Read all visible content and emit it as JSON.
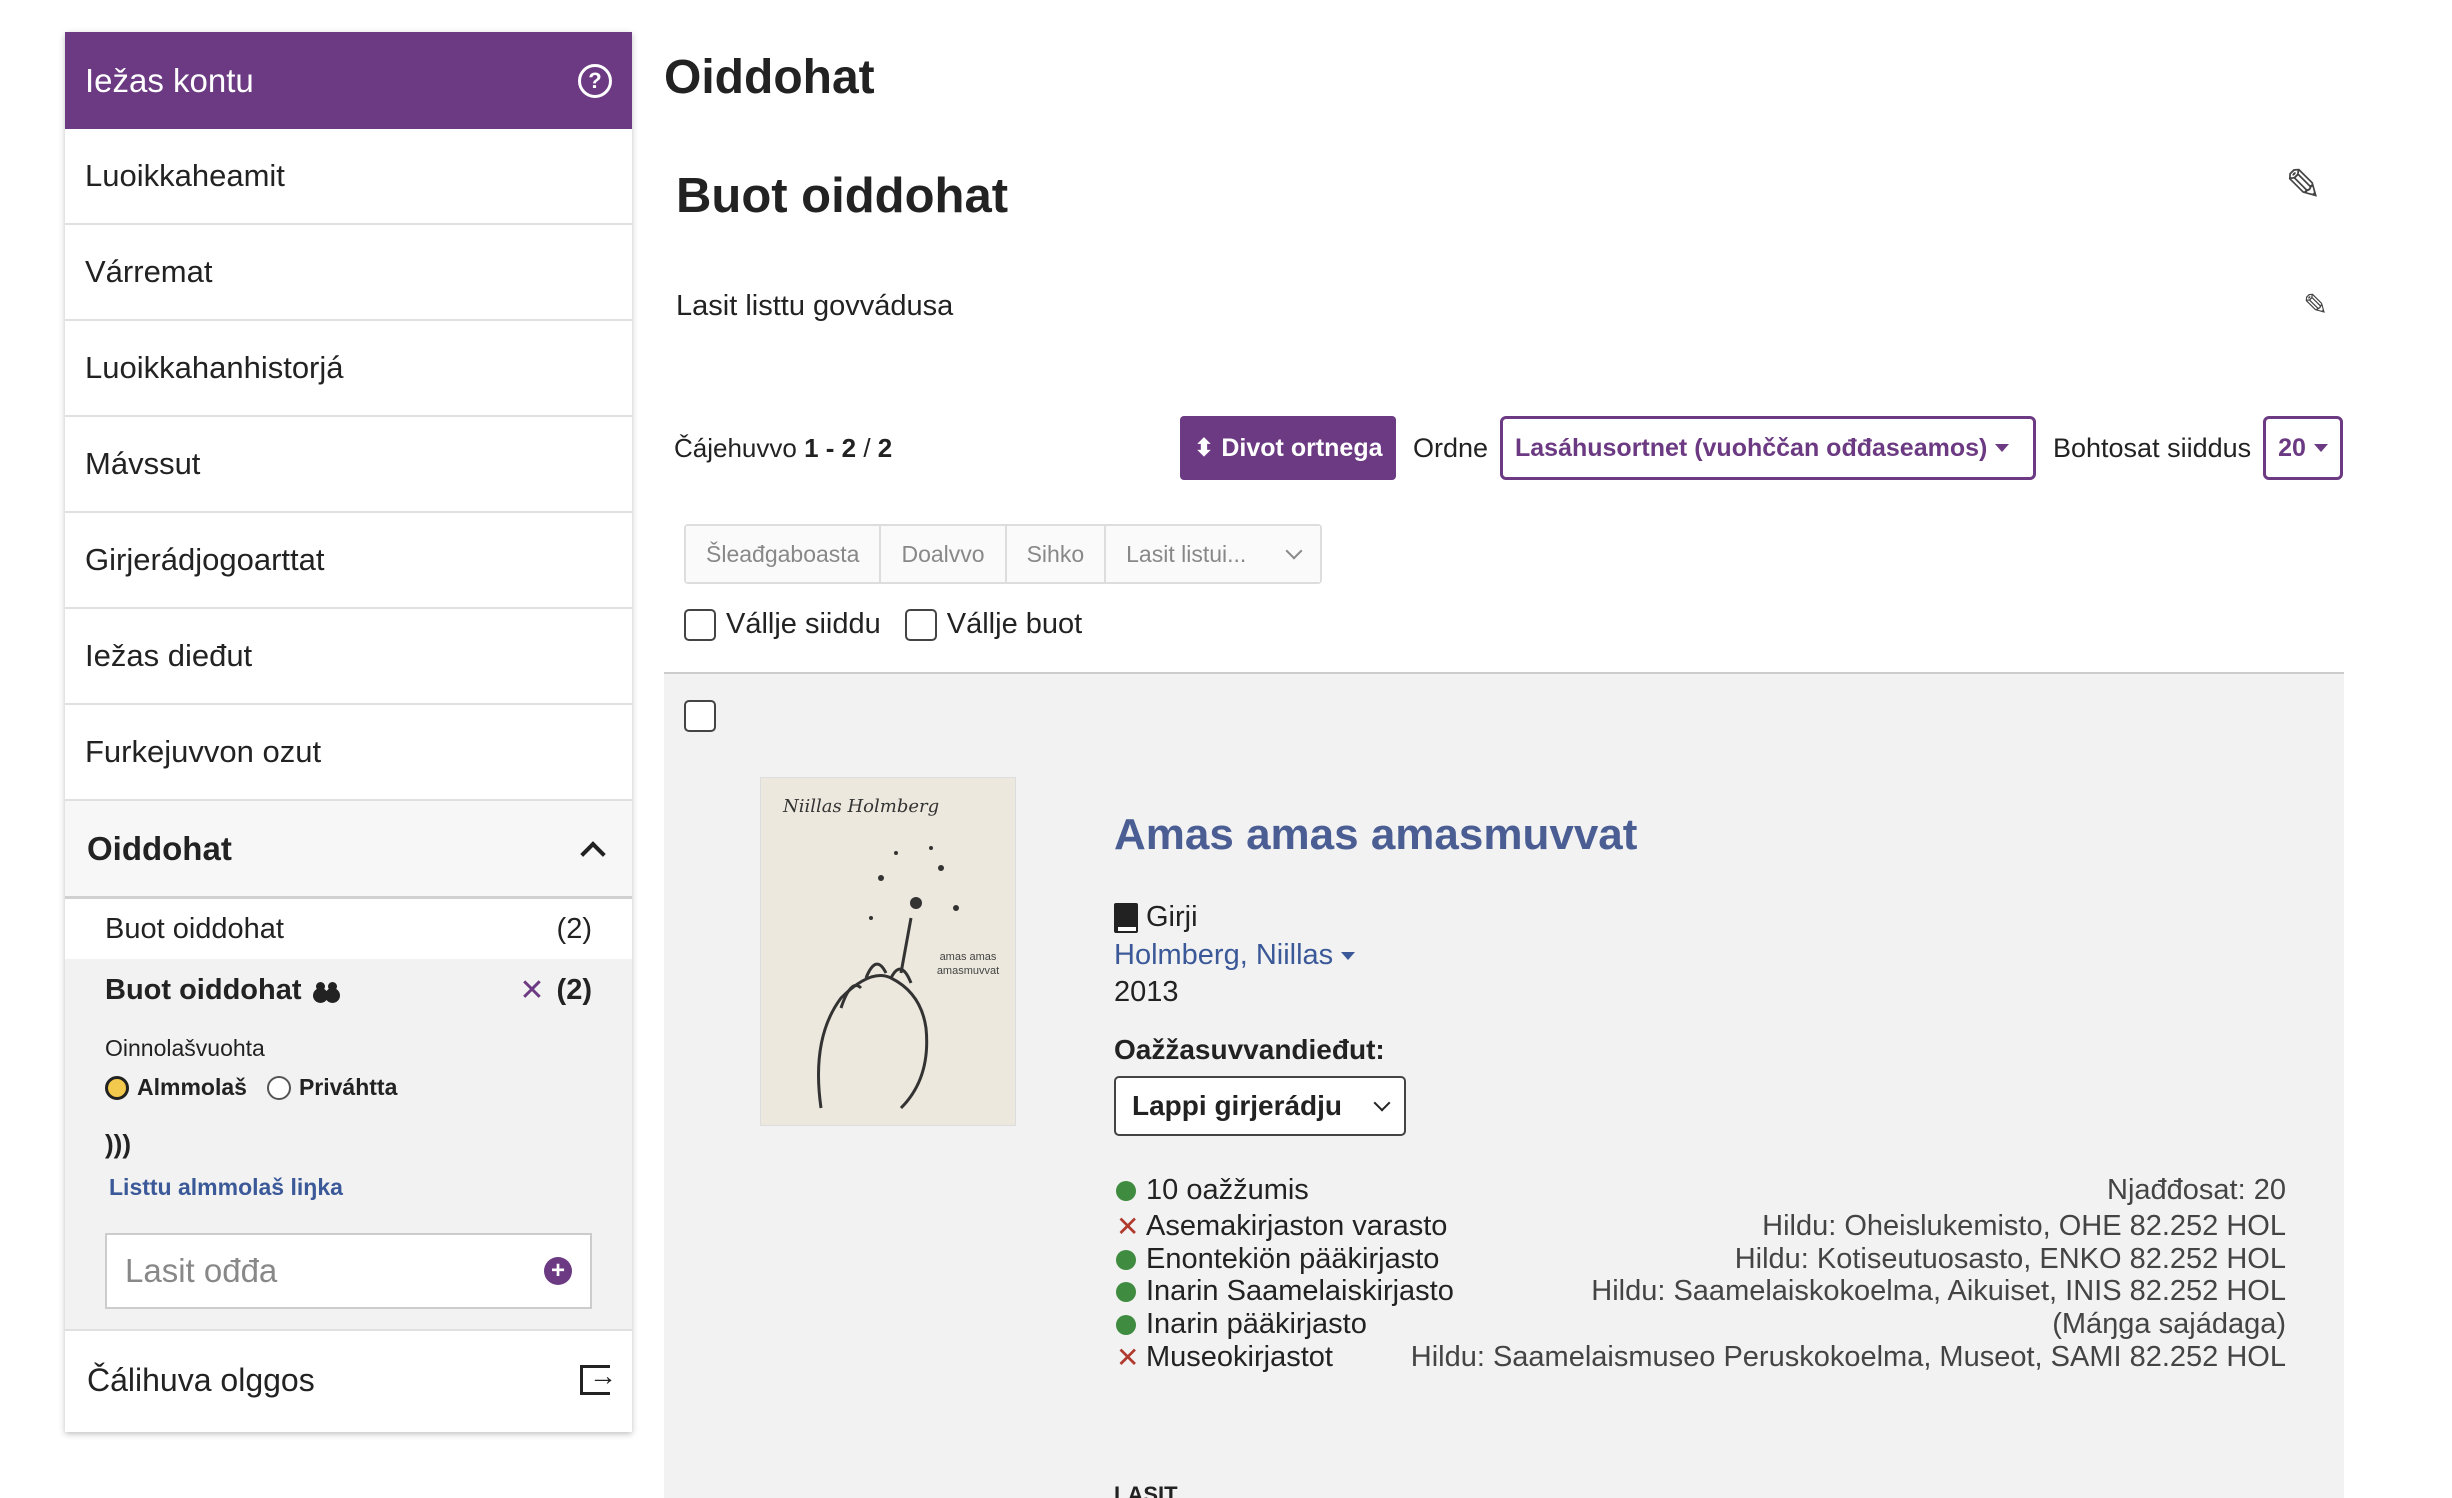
{
  "sidebar": {
    "title": "Iežas kontu",
    "items": [
      {
        "label": "Luoikkaheamit"
      },
      {
        "label": "Várremat"
      },
      {
        "label": "Luoikkahanhistorjá"
      },
      {
        "label": "Mávssut"
      },
      {
        "label": "Girjerádjogoarttat"
      },
      {
        "label": "Iežas dieđut"
      },
      {
        "label": "Furkejuvvon ozut"
      }
    ],
    "lists_header": "Oiddohat",
    "lists": [
      {
        "label": "Buot oiddohat",
        "count": "(2)"
      },
      {
        "label": "Buot oiddohat",
        "count": "(2)",
        "active": true
      }
    ],
    "privacy_label": "Oinnolašvuohta",
    "privacy_options": [
      "Almmolaš",
      "Priváhtta"
    ],
    "privacy_selected": "Almmolaš",
    "public_link": "Listtu almmolaš liŋka",
    "add_placeholder": "Lasit ođđa",
    "logout": "Čálihuva olggos"
  },
  "main": {
    "page_title": "Oiddohat",
    "list_title": "Buot oiddohat",
    "list_description": "Lasit listtu govvádusa",
    "results": {
      "prefix": "Čájehuvvo",
      "range": "1 - 2",
      "sep": " / ",
      "total": "2"
    },
    "sort_button": "⬍ Divot ortnega",
    "sort_label": "Ordne",
    "sort_value": "Lasáhusortnet (vuohččan ođđaseamos)",
    "per_page_label": "Bohtosat siiddus",
    "per_page_value": "20",
    "bulk_actions": [
      "Šleađgaboasta",
      "Doalvvo",
      "Sihko"
    ],
    "bulk_add_placeholder": "Lasit listui...",
    "select_page": "Vállje siiddu",
    "select_all": "Vállje buot"
  },
  "record": {
    "title": "Amas amas amasmuvvat",
    "format": "Girji",
    "author": "Holmberg, Niillas",
    "year": "2013",
    "holdings_label": "Oažžasuvvandieđut:",
    "location_select": "Lappi girjerádju",
    "cover_author": "Niillas Holmberg",
    "cover_subtitle": "amas amas amasmuvvat",
    "summary": {
      "available": "10 oažžumis",
      "reservations": "Njađđosat: 20"
    },
    "holdings": [
      {
        "library": "Asemakirjaston varasto",
        "status": "unavailable",
        "info": "Hildu: Oheislukemisto, OHE 82.252 HOL"
      },
      {
        "library": "Enontekiön pääkirjasto",
        "status": "available",
        "info": "Hildu: Kotiseutuosasto, ENKO 82.252 HOL"
      },
      {
        "library": "Inarin Saamelaiskirjasto",
        "status": "available",
        "info": "Hildu: Saamelaiskokoelma, Aikuiset, INIS 82.252 HOL"
      },
      {
        "library": "Inarin pääkirjasto",
        "status": "available",
        "info": "(Máŋga sajádaga)"
      },
      {
        "library": "Museokirjastot",
        "status": "unavailable",
        "info": "Hildu: Saamelaismuseo Peruskokoelma, Museot, SAMI 82.252 HOL"
      }
    ],
    "more_label": "LASIT"
  },
  "colors": {
    "brand": "#6b3a82",
    "link": "#4a5e94",
    "available": "#3f8b3f",
    "unavailable": "#b03a2e"
  }
}
